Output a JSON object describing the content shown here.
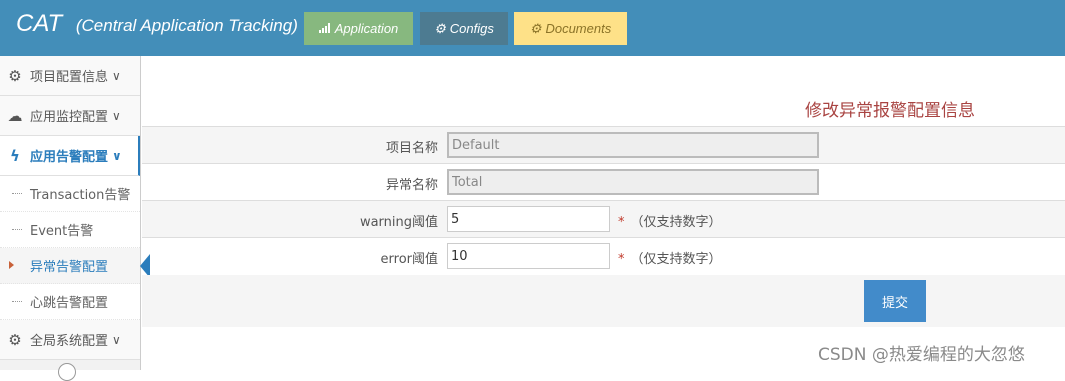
{
  "header": {
    "brand": "CAT",
    "subtitle": "(Central Application Tracking)",
    "buttons": [
      {
        "label": "Application",
        "icon": "signal-icon"
      },
      {
        "label": "Configs",
        "icon": "cogs-icon"
      },
      {
        "label": "Documents",
        "icon": "cogs-icon"
      }
    ]
  },
  "sidebar": {
    "sections": [
      {
        "label": "项目配置信息",
        "icon": "cogs-icon"
      },
      {
        "label": "应用监控配置",
        "icon": "cloud-icon"
      },
      {
        "label": "应用告警配置",
        "icon": "bolt-icon"
      },
      {
        "label": "全局系统配置",
        "icon": "gear-icon"
      }
    ],
    "subitems": [
      "Transaction告警",
      "Event告警",
      "异常告警配置",
      "心跳告警配置"
    ]
  },
  "form": {
    "title": "修改异常报警配置信息",
    "fields": [
      {
        "label": "项目名称",
        "value": "Default"
      },
      {
        "label": "异常名称",
        "value": "Total"
      },
      {
        "label": "warning阈值",
        "value": "5"
      },
      {
        "label": "error阈值",
        "value": "10"
      }
    ],
    "required_mark": "*",
    "hint": "（仅支持数字）",
    "submit_label": "提交"
  },
  "watermark": "CSDN @热爱编程的大忽悠",
  "colors": {
    "header": "#438eb9",
    "accent": "#2b7dbc",
    "title": "#a94442",
    "submit": "#428bca"
  }
}
